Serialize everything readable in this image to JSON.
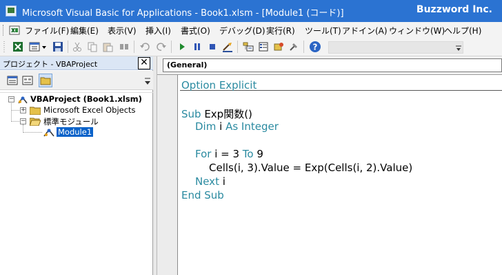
{
  "titlebar": {
    "title": "Microsoft Visual Basic for Applications - Book1.xlsm - [Module1 (コード)]",
    "brand": "Buzzword Inc."
  },
  "menu": [
    {
      "label": "ファイル(F)"
    },
    {
      "label": "編集(E)"
    },
    {
      "label": "表示(V)"
    },
    {
      "label": "挿入(I)"
    },
    {
      "label": "書式(O)"
    },
    {
      "label": "デバッグ(D)"
    },
    {
      "label": "実行(R)"
    },
    {
      "label": "ツール(T)"
    },
    {
      "label": "アドイン(A)"
    },
    {
      "label": "ウィンドウ(W)"
    },
    {
      "label": "ヘルプ(H)"
    }
  ],
  "toolbar": {
    "icons": [
      "view-excel-icon",
      "insert-module-icon",
      "save-icon",
      "cut-icon",
      "copy-icon",
      "paste-icon",
      "find-icon",
      "undo-icon",
      "redo-icon",
      "run-icon",
      "break-icon",
      "reset-icon",
      "design-mode-icon",
      "project-explorer-icon",
      "properties-icon",
      "object-browser-icon",
      "toolbox-icon",
      "help-icon"
    ]
  },
  "project": {
    "header": "プロジェクト - VBAProject",
    "close_glyph": "✕",
    "tree": {
      "root": "VBAProject (Book1.xlsm)",
      "excel_objects": "Microsoft Excel Objects",
      "modules_folder": "標準モジュール",
      "module": "Module1"
    }
  },
  "code": {
    "object_box": "(General)",
    "lines": {
      "l1_kw": "Option Explicit",
      "l2_kw": "Sub",
      "l2_rest": " Exp関数()",
      "l3_kw1": "Dim",
      "l3_mid": " i ",
      "l3_kw2": "As Integer",
      "l4_kw1": "For",
      "l4_mid": " i = 3 ",
      "l4_kw2": "To",
      "l4_end": " 9",
      "l5": "Cells(i, 3).Value = Exp(Cells(i, 2).Value)",
      "l6_kw": "Next",
      "l6_rest": " i",
      "l7_kw": "End Sub"
    }
  },
  "colors": {
    "titlebar": "#2b73d2",
    "keyword": "#2a8aa0",
    "selection": "#0a62c9"
  }
}
